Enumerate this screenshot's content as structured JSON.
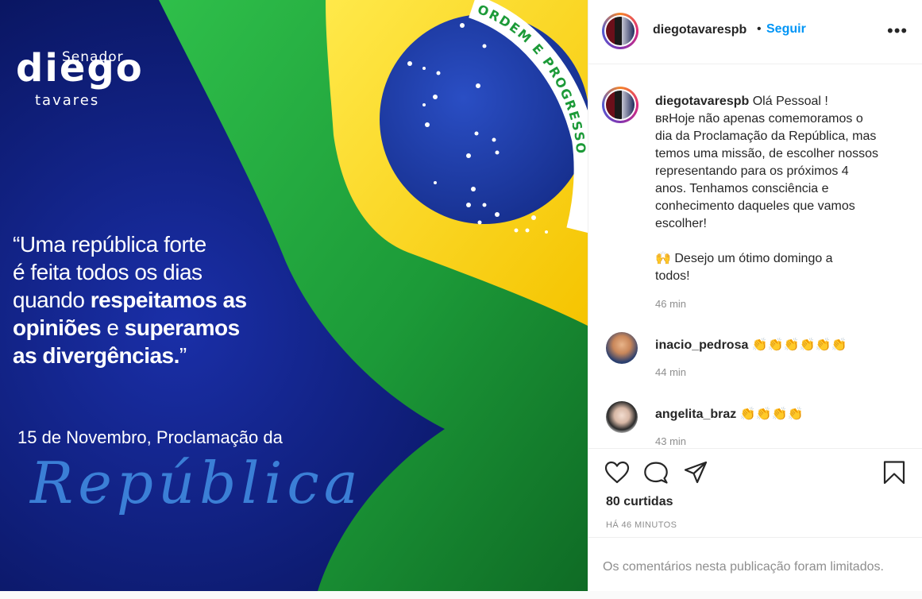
{
  "post_image": {
    "brand_senador": "Senador",
    "brand_diego": "diego",
    "brand_tavares": "tavares",
    "flag_motto": "ORDEM E PROGRESSO",
    "quote": {
      "p1": "“Uma república forte",
      "p2": "é feita todos os dias",
      "p3": "quando ",
      "p3_bold": "respeitamos as",
      "p4_bold": "opiniões",
      "p4": " e ",
      "p4_bold2": "superamos",
      "p5_bold": "as divergências.",
      "p5": "”"
    },
    "date_line": "15 de Novembro, Proclamação da",
    "script_word": "República",
    "colors": {
      "navy": "#0a1a6e",
      "green": "#1f9e3a",
      "yellow": "#ffdf00",
      "blue": "#1f3a9e",
      "script": "#3b7fd6"
    }
  },
  "header": {
    "username": "diegotavarespb",
    "separator": "•",
    "follow_label": "Seguir",
    "more_icon": "ellipsis-icon"
  },
  "caption": {
    "username": "diegotavarespb",
    "lines": [
      "Olá Pessoal !",
      "ʙʀHoje não apenas comemoramos o",
      "dia da Proclamação da República, mas",
      "temos uma missão, de escolher nossos",
      "representando para os próximos 4",
      "anos. Tenhamos consciência e",
      "conhecimento daqueles que vamos",
      "escolher!",
      "",
      "🙌 Desejo um ótimo domingo a",
      "todos!"
    ],
    "time": "46 min"
  },
  "comments": [
    {
      "username": "inacio_pedrosa",
      "text": "👏👏👏👏👏👏",
      "time": "44 min"
    },
    {
      "username": "angelita_braz",
      "text": "👏👏👏👏",
      "time": "43 min"
    }
  ],
  "actions": {
    "like_icon": "heart-icon",
    "comment_icon": "speech-bubble-icon",
    "share_icon": "paper-plane-icon",
    "save_icon": "bookmark-icon"
  },
  "likes_label": "80 curtidas",
  "posted_ago": "HÁ 46 MINUTOS",
  "comments_limited": "Os comentários nesta publicação foram limitados."
}
